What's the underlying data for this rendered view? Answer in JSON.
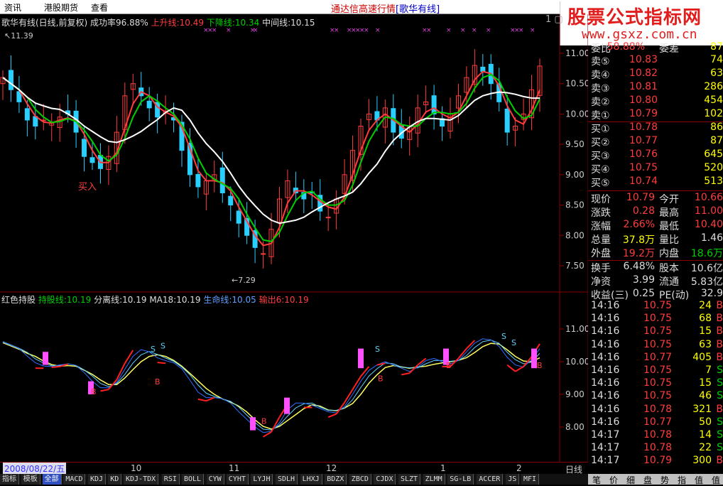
{
  "menubar": {
    "items": [
      "资讯",
      "港股期货",
      "查看"
    ],
    "center_title": "通达信高速行情",
    "center_link": "[歌华有线]"
  },
  "logo": {
    "title": "股票公式指标网",
    "url": "www.gsxz.com.cn"
  },
  "window_controls": "1 ▢",
  "main_chart": {
    "stock": "歌华有线(日线,前复权)",
    "success_rate": "成功率96.88%",
    "up_line": "上升线:10.49",
    "down_line": "下降线:10.34",
    "mid_line": "中间线:10.15",
    "high_marker": "11.39",
    "low_marker": "7.29",
    "buy_label": "买入",
    "y_ticks": [
      "11.00",
      "10.50",
      "10.00",
      "9.50",
      "9.00",
      "8.50",
      "8.00",
      "7.50"
    ],
    "colors": {
      "up": "#ff3d3d",
      "down": "#29d0ff",
      "green": "#00d000",
      "white": "#ffffff"
    }
  },
  "sub_chart": {
    "name": "红色持股",
    "hold_line": "持股线:10.19",
    "sep_line": "分离线:10.19",
    "ma18": "MA18:10.19",
    "life_line": "生命线:10.05",
    "output": "输出6:10.19",
    "y_ticks": [
      "11.00",
      "10.00",
      "9.00",
      "8.00"
    ],
    "signal_s": "S",
    "signal_b": "B"
  },
  "x_axis": {
    "date": "2008/08/22/五",
    "labels": [
      "10",
      "11",
      "12",
      "1",
      "2"
    ],
    "period": "日线"
  },
  "quote_panel": {
    "top_cut": [
      {
        "l": "委比",
        "v": "58.88%",
        "l2": "委差",
        "v2": "87"
      }
    ],
    "sell": [
      {
        "label": "卖⑤",
        "price": "10.83",
        "vol": "74"
      },
      {
        "label": "卖④",
        "price": "10.82",
        "vol": "63"
      },
      {
        "label": "卖③",
        "price": "10.81",
        "vol": "286"
      },
      {
        "label": "卖②",
        "price": "10.80",
        "vol": "454"
      },
      {
        "label": "卖①",
        "price": "10.79",
        "vol": "102"
      }
    ],
    "buy": [
      {
        "label": "买①",
        "price": "10.78",
        "vol": "86"
      },
      {
        "label": "买②",
        "price": "10.77",
        "vol": "87"
      },
      {
        "label": "买③",
        "price": "10.76",
        "vol": "645"
      },
      {
        "label": "买④",
        "price": "10.75",
        "vol": "520"
      },
      {
        "label": "买⑤",
        "price": "10.74",
        "vol": "513"
      }
    ],
    "stats": [
      {
        "l": "现价",
        "v": "10.79",
        "vc": "#ff3d3d",
        "l2": "今开",
        "v2": "10.66",
        "v2c": "#ff3d3d"
      },
      {
        "l": "涨跌",
        "v": "0.28",
        "vc": "#ff3d3d",
        "l2": "最高",
        "v2": "11.00",
        "v2c": "#ff3d3d"
      },
      {
        "l": "涨幅",
        "v": "2.66%",
        "vc": "#ff3d3d",
        "l2": "最低",
        "v2": "10.40",
        "v2c": "#ff3d3d"
      },
      {
        "l": "总量",
        "v": "37.8万",
        "vc": "#ff0",
        "l2": "量比",
        "v2": "1.46",
        "v2c": "#ddd"
      },
      {
        "l": "外盘",
        "v": "19.2万",
        "vc": "#ff3d3d",
        "l2": "内盘",
        "v2": "18.6万",
        "v2c": "#00d000"
      },
      {
        "l": "换手",
        "v": "6.48%",
        "vc": "#ddd",
        "l2": "股本",
        "v2": "10.6亿",
        "v2c": "#ddd"
      },
      {
        "l": "净资",
        "v": "3.99",
        "vc": "#ddd",
        "l2": "流通",
        "v2": "5.83亿",
        "v2c": "#ddd"
      },
      {
        "l": "收益(三)",
        "v": "0.25",
        "vc": "#ddd",
        "l2": "PE(动)",
        "v2": "32.9",
        "v2c": "#ddd"
      }
    ]
  },
  "ticks": [
    {
      "t": "14:16",
      "p": "10.75",
      "q": "24",
      "s": "B"
    },
    {
      "t": "14:16",
      "p": "10.75",
      "q": "68",
      "s": "B"
    },
    {
      "t": "14:16",
      "p": "10.75",
      "q": "15",
      "s": "B"
    },
    {
      "t": "14:16",
      "p": "10.75",
      "q": "63",
      "s": "B"
    },
    {
      "t": "14:16",
      "p": "10.77",
      "q": "405",
      "s": "B"
    },
    {
      "t": "14:16",
      "p": "10.75",
      "q": "7",
      "s": "S"
    },
    {
      "t": "14:16",
      "p": "10.75",
      "q": "15",
      "s": "S"
    },
    {
      "t": "14:16",
      "p": "10.75",
      "q": "46",
      "s": "S"
    },
    {
      "t": "14:16",
      "p": "10.78",
      "q": "321",
      "s": "B"
    },
    {
      "t": "14:16",
      "p": "10.77",
      "q": "50",
      "s": "S"
    },
    {
      "t": "14:17",
      "p": "10.78",
      "q": "14",
      "s": "S"
    },
    {
      "t": "14:17",
      "p": "10.78",
      "q": "22",
      "s": "S"
    },
    {
      "t": "14:17",
      "p": "10.79",
      "q": "300",
      "s": "B"
    }
  ],
  "bottom_tabs": [
    "指标",
    "模板",
    "全部",
    "MACD",
    "KDJ",
    "KD",
    "KDJ-TDX",
    "RSI",
    "BOLL",
    "CYW",
    "CYHT",
    "LYJH",
    "SDLH",
    "LHXJ",
    "BDZX",
    "ZBCD",
    "CJDX",
    "SLZT",
    "ZLMM",
    "SG-LB",
    "ACCER",
    "JS",
    "MFI"
  ],
  "right_tabs": [
    "笔",
    "价",
    "细",
    "盘",
    "势",
    "指",
    "值",
    "值"
  ]
}
